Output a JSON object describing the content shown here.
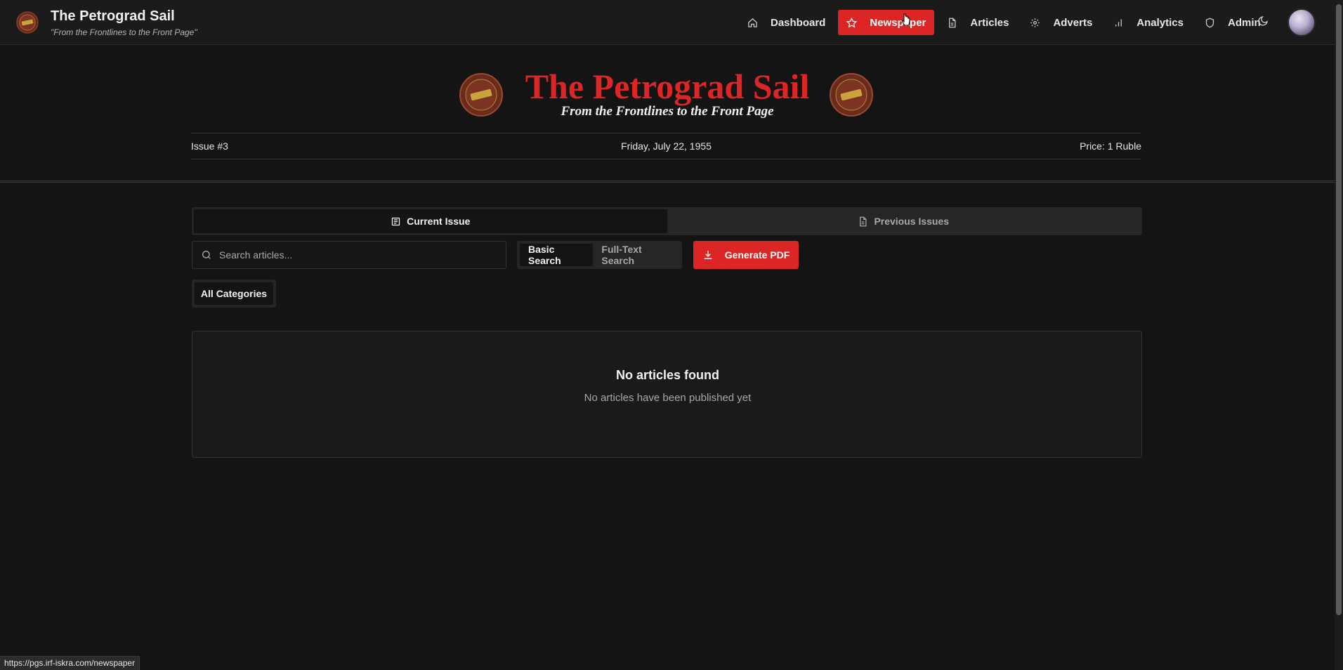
{
  "brand": {
    "title": "The Petrograd Sail",
    "tagline": "\"From the Frontlines to the Front Page\""
  },
  "nav": {
    "items": [
      {
        "label": "Dashboard",
        "icon": "home-icon"
      },
      {
        "label": "Newspaper",
        "icon": "star-icon",
        "active": true
      },
      {
        "label": "Articles",
        "icon": "document-icon"
      },
      {
        "label": "Adverts",
        "icon": "gear-icon"
      },
      {
        "label": "Analytics",
        "icon": "bar-chart-icon"
      },
      {
        "label": "Admin",
        "icon": "shield-icon"
      }
    ],
    "theme_toggle_icon": "moon-icon"
  },
  "masthead": {
    "title": "The Petrograd Sail",
    "subtitle": "From the Frontlines to the Front Page",
    "issue": "Issue #3",
    "date": "Friday, July 22, 1955",
    "price": "Price: 1 Ruble"
  },
  "tabs": [
    {
      "label": "Current Issue",
      "icon": "newspaper-icon",
      "active": true
    },
    {
      "label": "Previous Issues",
      "icon": "document-icon",
      "active": false
    }
  ],
  "search": {
    "placeholder": "Search articles...",
    "value": "",
    "modes": [
      {
        "label": "Basic Search",
        "active": true
      },
      {
        "label": "Full-Text Search",
        "active": false
      }
    ],
    "generate_pdf_label": "Generate PDF"
  },
  "categories": {
    "selected": "All Categories"
  },
  "empty_state": {
    "title": "No articles found",
    "message": "No articles have been published yet"
  },
  "status_url": "https://pgs.irf-iskra.com/newspaper",
  "colors": {
    "accent": "#dc2626",
    "background": "#141414",
    "surface": "#1b1b1b"
  }
}
